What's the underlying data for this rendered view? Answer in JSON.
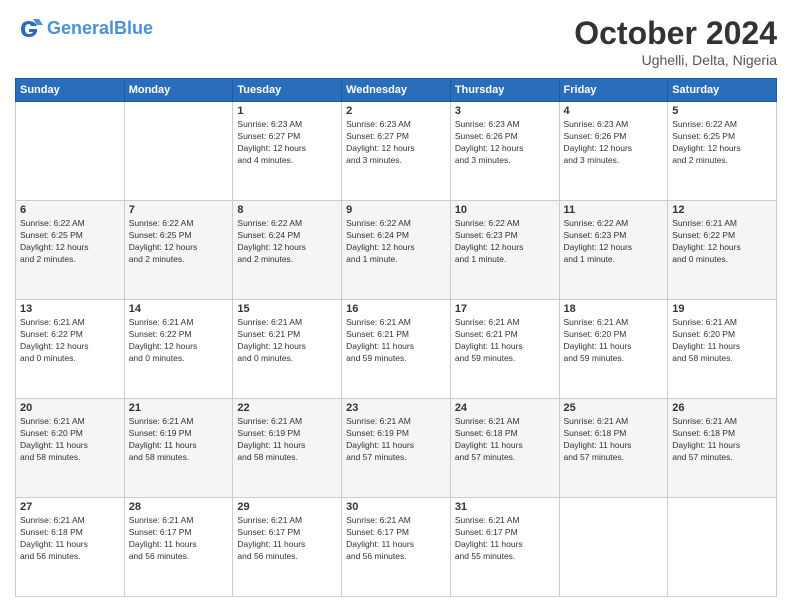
{
  "header": {
    "logo_line1": "General",
    "logo_line2": "Blue",
    "month": "October 2024",
    "location": "Ughelli, Delta, Nigeria"
  },
  "weekdays": [
    "Sunday",
    "Monday",
    "Tuesday",
    "Wednesday",
    "Thursday",
    "Friday",
    "Saturday"
  ],
  "weeks": [
    [
      {
        "day": "",
        "info": ""
      },
      {
        "day": "",
        "info": ""
      },
      {
        "day": "1",
        "info": "Sunrise: 6:23 AM\nSunset: 6:27 PM\nDaylight: 12 hours\nand 4 minutes."
      },
      {
        "day": "2",
        "info": "Sunrise: 6:23 AM\nSunset: 6:27 PM\nDaylight: 12 hours\nand 3 minutes."
      },
      {
        "day": "3",
        "info": "Sunrise: 6:23 AM\nSunset: 6:26 PM\nDaylight: 12 hours\nand 3 minutes."
      },
      {
        "day": "4",
        "info": "Sunrise: 6:23 AM\nSunset: 6:26 PM\nDaylight: 12 hours\nand 3 minutes."
      },
      {
        "day": "5",
        "info": "Sunrise: 6:22 AM\nSunset: 6:25 PM\nDaylight: 12 hours\nand 2 minutes."
      }
    ],
    [
      {
        "day": "6",
        "info": "Sunrise: 6:22 AM\nSunset: 6:25 PM\nDaylight: 12 hours\nand 2 minutes."
      },
      {
        "day": "7",
        "info": "Sunrise: 6:22 AM\nSunset: 6:25 PM\nDaylight: 12 hours\nand 2 minutes."
      },
      {
        "day": "8",
        "info": "Sunrise: 6:22 AM\nSunset: 6:24 PM\nDaylight: 12 hours\nand 2 minutes."
      },
      {
        "day": "9",
        "info": "Sunrise: 6:22 AM\nSunset: 6:24 PM\nDaylight: 12 hours\nand 1 minute."
      },
      {
        "day": "10",
        "info": "Sunrise: 6:22 AM\nSunset: 6:23 PM\nDaylight: 12 hours\nand 1 minute."
      },
      {
        "day": "11",
        "info": "Sunrise: 6:22 AM\nSunset: 6:23 PM\nDaylight: 12 hours\nand 1 minute."
      },
      {
        "day": "12",
        "info": "Sunrise: 6:21 AM\nSunset: 6:22 PM\nDaylight: 12 hours\nand 0 minutes."
      }
    ],
    [
      {
        "day": "13",
        "info": "Sunrise: 6:21 AM\nSunset: 6:22 PM\nDaylight: 12 hours\nand 0 minutes."
      },
      {
        "day": "14",
        "info": "Sunrise: 6:21 AM\nSunset: 6:22 PM\nDaylight: 12 hours\nand 0 minutes."
      },
      {
        "day": "15",
        "info": "Sunrise: 6:21 AM\nSunset: 6:21 PM\nDaylight: 12 hours\nand 0 minutes."
      },
      {
        "day": "16",
        "info": "Sunrise: 6:21 AM\nSunset: 6:21 PM\nDaylight: 11 hours\nand 59 minutes."
      },
      {
        "day": "17",
        "info": "Sunrise: 6:21 AM\nSunset: 6:21 PM\nDaylight: 11 hours\nand 59 minutes."
      },
      {
        "day": "18",
        "info": "Sunrise: 6:21 AM\nSunset: 6:20 PM\nDaylight: 11 hours\nand 59 minutes."
      },
      {
        "day": "19",
        "info": "Sunrise: 6:21 AM\nSunset: 6:20 PM\nDaylight: 11 hours\nand 58 minutes."
      }
    ],
    [
      {
        "day": "20",
        "info": "Sunrise: 6:21 AM\nSunset: 6:20 PM\nDaylight: 11 hours\nand 58 minutes."
      },
      {
        "day": "21",
        "info": "Sunrise: 6:21 AM\nSunset: 6:19 PM\nDaylight: 11 hours\nand 58 minutes."
      },
      {
        "day": "22",
        "info": "Sunrise: 6:21 AM\nSunset: 6:19 PM\nDaylight: 11 hours\nand 58 minutes."
      },
      {
        "day": "23",
        "info": "Sunrise: 6:21 AM\nSunset: 6:19 PM\nDaylight: 11 hours\nand 57 minutes."
      },
      {
        "day": "24",
        "info": "Sunrise: 6:21 AM\nSunset: 6:18 PM\nDaylight: 11 hours\nand 57 minutes."
      },
      {
        "day": "25",
        "info": "Sunrise: 6:21 AM\nSunset: 6:18 PM\nDaylight: 11 hours\nand 57 minutes."
      },
      {
        "day": "26",
        "info": "Sunrise: 6:21 AM\nSunset: 6:18 PM\nDaylight: 11 hours\nand 57 minutes."
      }
    ],
    [
      {
        "day": "27",
        "info": "Sunrise: 6:21 AM\nSunset: 6:18 PM\nDaylight: 11 hours\nand 56 minutes."
      },
      {
        "day": "28",
        "info": "Sunrise: 6:21 AM\nSunset: 6:17 PM\nDaylight: 11 hours\nand 56 minutes."
      },
      {
        "day": "29",
        "info": "Sunrise: 6:21 AM\nSunset: 6:17 PM\nDaylight: 11 hours\nand 56 minutes."
      },
      {
        "day": "30",
        "info": "Sunrise: 6:21 AM\nSunset: 6:17 PM\nDaylight: 11 hours\nand 56 minutes."
      },
      {
        "day": "31",
        "info": "Sunrise: 6:21 AM\nSunset: 6:17 PM\nDaylight: 11 hours\nand 55 minutes."
      },
      {
        "day": "",
        "info": ""
      },
      {
        "day": "",
        "info": ""
      }
    ]
  ]
}
